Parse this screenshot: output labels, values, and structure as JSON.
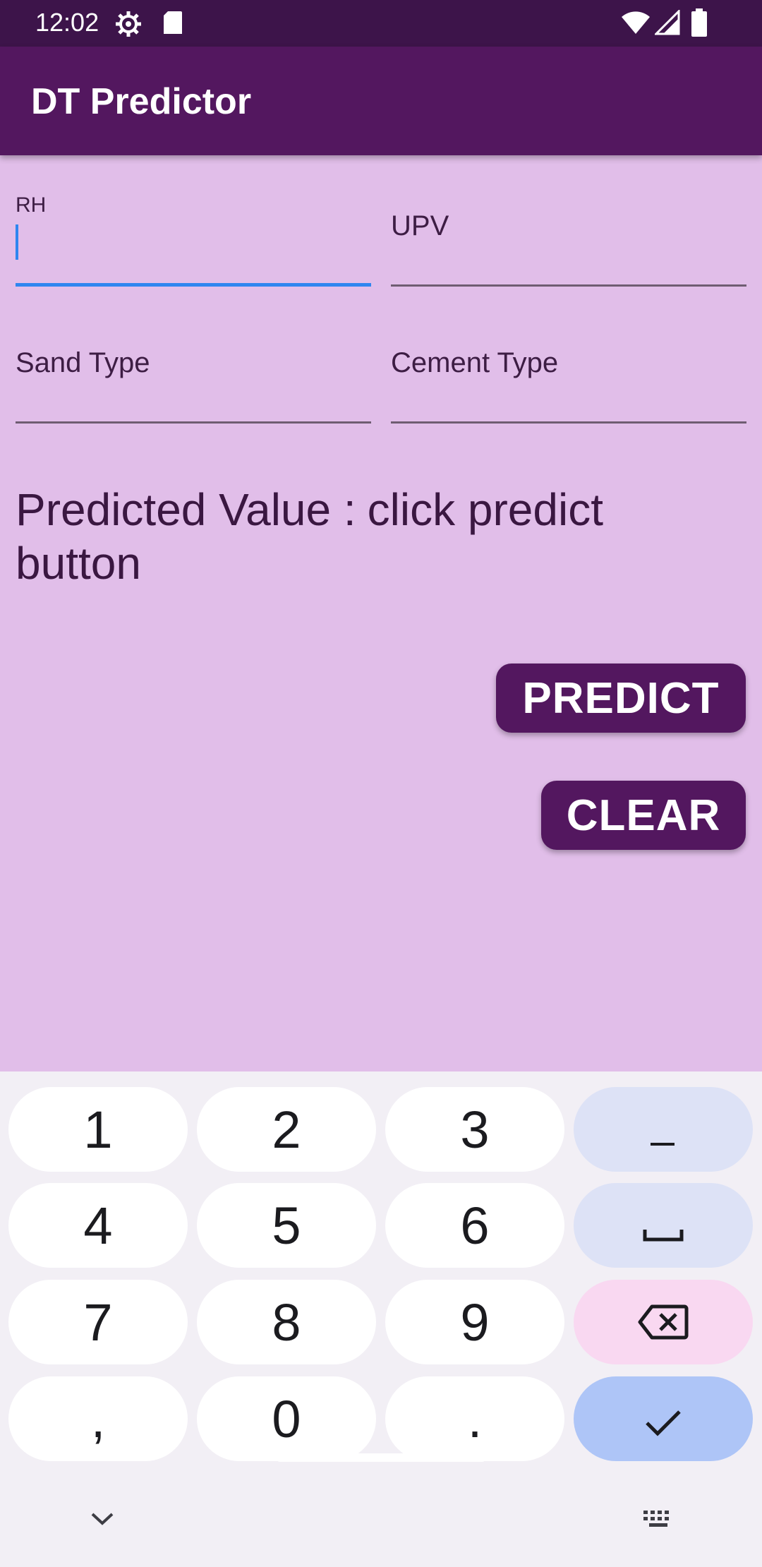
{
  "status_bar": {
    "time": "12:02",
    "left_icons": [
      "settings-icon",
      "sd-card-icon"
    ],
    "right_icons": [
      "wifi-icon",
      "signal-icon",
      "battery-icon"
    ]
  },
  "app": {
    "title": "DT Predictor"
  },
  "form": {
    "rh_label": "RH",
    "upv_label": "UPV",
    "sand_label": "Sand Type",
    "cement_label": "Cement Type"
  },
  "result": {
    "label": "Predicted Value :",
    "value": "click predict button"
  },
  "buttons": {
    "predict": "PREDICT",
    "clear": "CLEAR"
  },
  "keyboard": {
    "keys": [
      "1",
      "2",
      "3",
      "–",
      "4",
      "5",
      "6",
      "␣",
      "7",
      "8",
      "9",
      "⌫",
      ",",
      "0",
      ".",
      "✓"
    ],
    "key_icons": [
      "",
      "",
      "",
      "minus-icon",
      "",
      "",
      "",
      "space-icon",
      "",
      "",
      "",
      "backspace-icon",
      "",
      "",
      "",
      "done-check-icon"
    ]
  },
  "colors": {
    "app_bar": "#53175f",
    "status_bar": "#3d144a",
    "background": "#e1bee9",
    "focus": "#2f86f0"
  }
}
